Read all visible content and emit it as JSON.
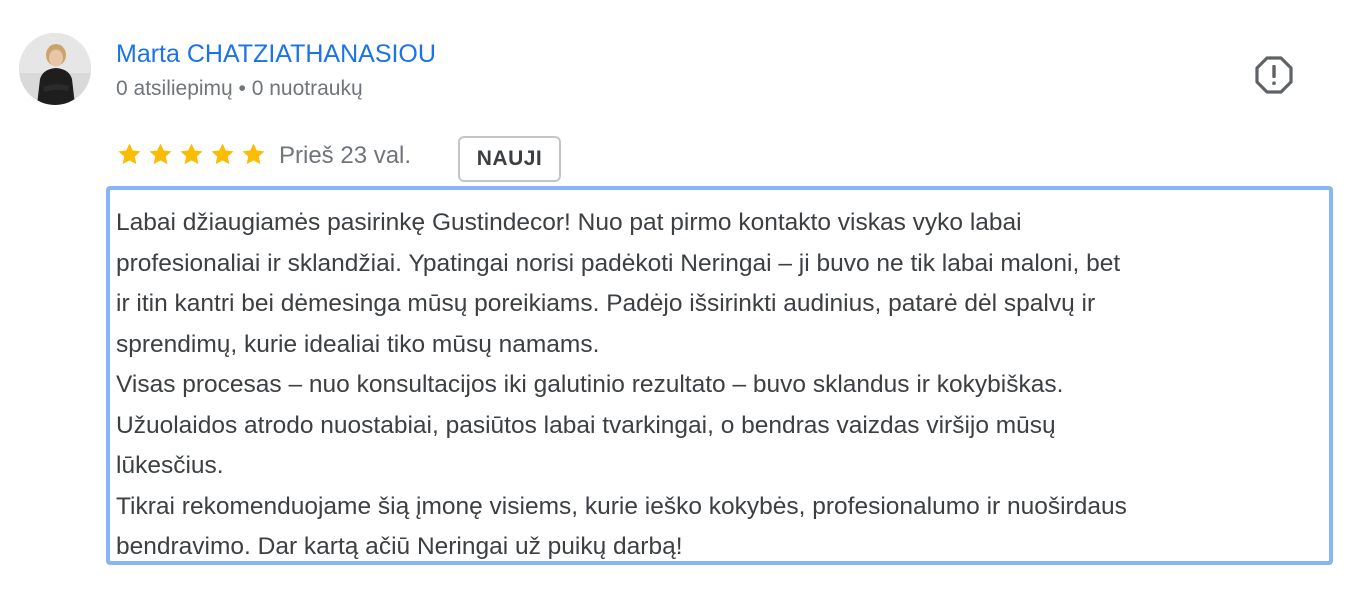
{
  "author": {
    "name": "Marta CHATZIATHANASIOU",
    "meta": "0 atsiliepimų • 0 nuotraukų"
  },
  "review": {
    "rating": 5,
    "max_rating": 5,
    "time": "Prieš 23 val.",
    "badge": "NAUJI",
    "lines": [
      "Labai džiaugiamės pasirinkę Gustindecor! Nuo pat pirmo kontakto viskas vyko labai",
      "profesionaliai ir sklandžiai. Ypatingai norisi padėkoti Neringai – ji buvo ne tik labai maloni, bet",
      "ir itin kantri bei dėmesinga mūsų poreikiams. Padėjo išsirinkti audinius, patarė dėl spalvų ir",
      "sprendimų, kurie idealiai tiko mūsų namams.",
      "Visas procesas – nuo konsultacijos iki galutinio rezultato – buvo sklandus ir kokybiškas.",
      "Užuolaidos atrodo nuostabiai, pasiūtos labai tvarkingai, o bendras vaizdas viršijo mūsų",
      "lūkesčius.",
      "Tikrai rekomenduojame šią įmonę visiems, kurie ieško kokybės, profesionalumo ir nuoširdaus",
      "bendravimo. Dar kartą ačiū Neringai už puikų darbą!"
    ]
  },
  "icons": {
    "star": "star-icon",
    "report": "report-flag-octagon-icon"
  },
  "colors": {
    "author_link": "#1a73e8",
    "star": "#fbbc04",
    "secondary_text": "#70757a",
    "body_text": "#3c4043",
    "focus_border": "#8ab4f8"
  }
}
